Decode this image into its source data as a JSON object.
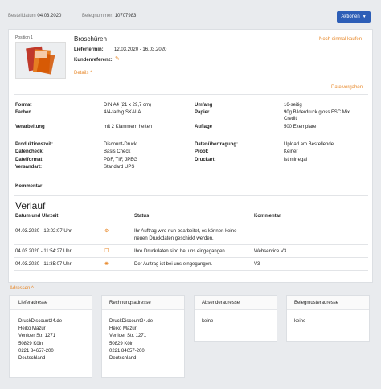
{
  "header": {
    "order_date_label": "Bestelldatum",
    "order_date": "04.03.2020",
    "order_number_label": "Belegnummer:",
    "order_number": "10707983",
    "actions_label": "Aktionen"
  },
  "position": {
    "label": "Position 1",
    "product": "Broschüren",
    "reorder": "Noch einmal kaufen",
    "delivery_label": "Liefertermin:",
    "delivery_value": "12.03.2020 - 16.03.2020",
    "customer_ref_label": "Kundenreferenz:",
    "details_label": "Details",
    "file_specs": "Dateivorgaben"
  },
  "specs": {
    "format_label": "Format",
    "format_value": "DIN A4 (21 x 29,7 cm)",
    "colors_label": "Farben",
    "colors_value": "4/4-farbig SKALA",
    "processing_label": "Verarbeitung",
    "processing_value": "mit 2 Klammern heften",
    "scope_label": "Umfang",
    "scope_value": "16-seitig",
    "paper_label": "Papier",
    "paper_value_1": "90g Bilderdruck gloss FSC Mix",
    "paper_value_2": "Credit",
    "edition_label": "Auflage",
    "edition_value": "500 Exemplare",
    "production_label": "Produktionszeit:",
    "production_value": "Discount-Druck",
    "datacheck_label": "Datencheck:",
    "datacheck_value": "Basis Check",
    "fileformat_label": "Dateiformat:",
    "fileformat_value": "PDF, TIF, JPEG",
    "shipping_label": "Versandart:",
    "shipping_value": "Standard UPS",
    "transfer_label": "Datenübertragung:",
    "transfer_value": "Upload am Bestellende",
    "proof_label": "Proof:",
    "proof_value": "Keiner",
    "printtype_label": "Druckart:",
    "printtype_value": "ist mir egal",
    "comment_label": "Kommentar"
  },
  "history": {
    "title": "Verlauf",
    "col_date": "Datum und Uhrzeit",
    "col_status": "Status",
    "col_comment": "Kommentar",
    "rows": [
      {
        "date": "04.03.2020 - 12:02:07 Uhr",
        "status_1": "Ihr Auftrag wird nun bearbeitet, es können keine",
        "status_2": "neuen Druckdaten geschickt werden.",
        "comment": "",
        "icon": "gears-icon"
      },
      {
        "date": "04.03.2020 - 11:54:27 Uhr",
        "status_1": "Ihre Druckdaten sind bei uns eingegangen.",
        "status_2": "",
        "comment": "Webservice V3",
        "icon": "files-icon"
      },
      {
        "date": "04.03.2020 - 11:35:07 Uhr",
        "status_1": "Der Auftrag ist bei uns eingegangen.",
        "status_2": "",
        "comment": "V3",
        "icon": "sun-icon"
      }
    ]
  },
  "addresses": {
    "toggle_label": "Adressen",
    "shipping": {
      "title": "Lieferadresse",
      "lines": [
        "DruckDiscount24.de",
        "Heiko Mazur",
        "Venloer Str. 1271",
        "50829 Köln",
        "0221 84657-200",
        "Deutschland"
      ]
    },
    "billing": {
      "title": "Rechnungsadresse",
      "lines": [
        "DruckDiscount24.de",
        "Heiko Mazur",
        "Venloer Str. 1271",
        "50829 Köln",
        "0221 84657-200",
        "Deutschland"
      ]
    },
    "sender": {
      "title": "Absenderadresse",
      "value": "keine"
    },
    "template": {
      "title": "Belegmusteradresse",
      "value": "keine"
    }
  },
  "colors": {
    "accent": "#e8892b",
    "primary": "#2d5eb7"
  }
}
